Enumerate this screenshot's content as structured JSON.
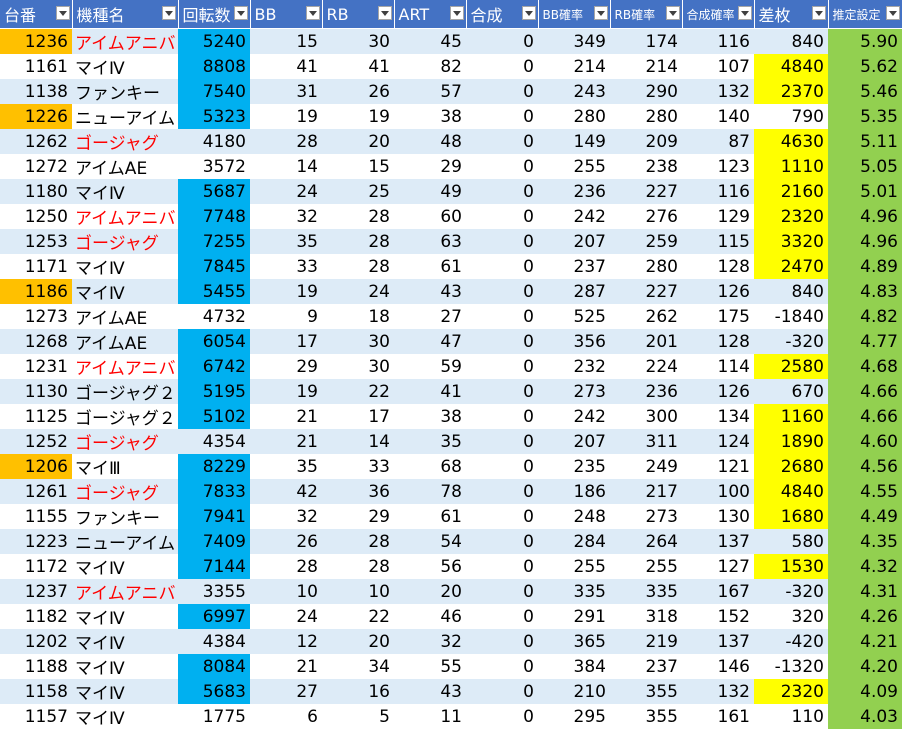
{
  "headers": [
    "台番",
    "機種名",
    "回転数",
    "BB",
    "RB",
    "ART",
    "合成",
    "BB確率",
    "RB確率",
    "合成確率",
    "差枚",
    "推定設定"
  ],
  "colors": {
    "header": "#4472c4",
    "band": "#ddebf7",
    "highlight_number": "#ffc000",
    "highlight_spins": "#00b0f0",
    "highlight_diff": "#ffff00",
    "setting": "#92d050",
    "red_text": "#ff0000"
  },
  "rows": [
    {
      "cells": [
        "1236",
        "アイムアニバ",
        "5240",
        "15",
        "30",
        "45",
        "0",
        "349",
        "174",
        "116",
        "840",
        "5.90"
      ],
      "num_hl": true,
      "name_red": true,
      "spins_hl": true,
      "diff_hl": false
    },
    {
      "cells": [
        "1161",
        "マイⅣ",
        "8808",
        "41",
        "41",
        "82",
        "0",
        "214",
        "214",
        "107",
        "4840",
        "5.62"
      ],
      "num_hl": false,
      "name_red": false,
      "spins_hl": true,
      "diff_hl": true
    },
    {
      "cells": [
        "1138",
        "ファンキー",
        "7540",
        "31",
        "26",
        "57",
        "0",
        "243",
        "290",
        "132",
        "2370",
        "5.46"
      ],
      "num_hl": false,
      "name_red": false,
      "spins_hl": true,
      "diff_hl": true
    },
    {
      "cells": [
        "1226",
        "ニューアイム",
        "5323",
        "19",
        "19",
        "38",
        "0",
        "280",
        "280",
        "140",
        "790",
        "5.35"
      ],
      "num_hl": true,
      "name_red": false,
      "spins_hl": true,
      "diff_hl": false
    },
    {
      "cells": [
        "1262",
        "ゴージャグ",
        "4180",
        "28",
        "20",
        "48",
        "0",
        "149",
        "209",
        "87",
        "4630",
        "5.11"
      ],
      "num_hl": false,
      "name_red": true,
      "spins_hl": false,
      "diff_hl": true
    },
    {
      "cells": [
        "1272",
        "アイムAE",
        "3572",
        "14",
        "15",
        "29",
        "0",
        "255",
        "238",
        "123",
        "1110",
        "5.05"
      ],
      "num_hl": false,
      "name_red": false,
      "spins_hl": false,
      "diff_hl": true
    },
    {
      "cells": [
        "1180",
        "マイⅣ",
        "5687",
        "24",
        "25",
        "49",
        "0",
        "236",
        "227",
        "116",
        "2160",
        "5.01"
      ],
      "num_hl": false,
      "name_red": false,
      "spins_hl": true,
      "diff_hl": true
    },
    {
      "cells": [
        "1250",
        "アイムアニバ",
        "7748",
        "32",
        "28",
        "60",
        "0",
        "242",
        "276",
        "129",
        "2320",
        "4.96"
      ],
      "num_hl": false,
      "name_red": true,
      "spins_hl": true,
      "diff_hl": true
    },
    {
      "cells": [
        "1253",
        "ゴージャグ",
        "7255",
        "35",
        "28",
        "63",
        "0",
        "207",
        "259",
        "115",
        "3320",
        "4.96"
      ],
      "num_hl": false,
      "name_red": true,
      "spins_hl": true,
      "diff_hl": true
    },
    {
      "cells": [
        "1171",
        "マイⅣ",
        "7845",
        "33",
        "28",
        "61",
        "0",
        "237",
        "280",
        "128",
        "2470",
        "4.89"
      ],
      "num_hl": false,
      "name_red": false,
      "spins_hl": true,
      "diff_hl": true
    },
    {
      "cells": [
        "1186",
        "マイⅣ",
        "5455",
        "19",
        "24",
        "43",
        "0",
        "287",
        "227",
        "126",
        "840",
        "4.83"
      ],
      "num_hl": true,
      "name_red": false,
      "spins_hl": true,
      "diff_hl": false
    },
    {
      "cells": [
        "1273",
        "アイムAE",
        "4732",
        "9",
        "18",
        "27",
        "0",
        "525",
        "262",
        "175",
        "-1840",
        "4.82"
      ],
      "num_hl": false,
      "name_red": false,
      "spins_hl": false,
      "diff_hl": false
    },
    {
      "cells": [
        "1268",
        "アイムAE",
        "6054",
        "17",
        "30",
        "47",
        "0",
        "356",
        "201",
        "128",
        "-320",
        "4.77"
      ],
      "num_hl": false,
      "name_red": false,
      "spins_hl": true,
      "diff_hl": false
    },
    {
      "cells": [
        "1231",
        "アイムアニバ",
        "6742",
        "29",
        "30",
        "59",
        "0",
        "232",
        "224",
        "114",
        "2580",
        "4.68"
      ],
      "num_hl": false,
      "name_red": true,
      "spins_hl": true,
      "diff_hl": true
    },
    {
      "cells": [
        "1130",
        "ゴージャグ２",
        "5195",
        "19",
        "22",
        "41",
        "0",
        "273",
        "236",
        "126",
        "670",
        "4.66"
      ],
      "num_hl": false,
      "name_red": false,
      "spins_hl": true,
      "diff_hl": false
    },
    {
      "cells": [
        "1125",
        "ゴージャグ２",
        "5102",
        "21",
        "17",
        "38",
        "0",
        "242",
        "300",
        "134",
        "1160",
        "4.66"
      ],
      "num_hl": false,
      "name_red": false,
      "spins_hl": true,
      "diff_hl": true
    },
    {
      "cells": [
        "1252",
        "ゴージャグ",
        "4354",
        "21",
        "14",
        "35",
        "0",
        "207",
        "311",
        "124",
        "1890",
        "4.60"
      ],
      "num_hl": false,
      "name_red": true,
      "spins_hl": false,
      "diff_hl": true
    },
    {
      "cells": [
        "1206",
        "マイⅢ",
        "8229",
        "35",
        "33",
        "68",
        "0",
        "235",
        "249",
        "121",
        "2680",
        "4.56"
      ],
      "num_hl": true,
      "name_red": false,
      "spins_hl": true,
      "diff_hl": true
    },
    {
      "cells": [
        "1261",
        "ゴージャグ",
        "7833",
        "42",
        "36",
        "78",
        "0",
        "186",
        "217",
        "100",
        "4840",
        "4.55"
      ],
      "num_hl": false,
      "name_red": true,
      "spins_hl": true,
      "diff_hl": true
    },
    {
      "cells": [
        "1155",
        "ファンキー",
        "7941",
        "32",
        "29",
        "61",
        "0",
        "248",
        "273",
        "130",
        "1680",
        "4.49"
      ],
      "num_hl": false,
      "name_red": false,
      "spins_hl": true,
      "diff_hl": true
    },
    {
      "cells": [
        "1223",
        "ニューアイム",
        "7409",
        "26",
        "28",
        "54",
        "0",
        "284",
        "264",
        "137",
        "580",
        "4.35"
      ],
      "num_hl": false,
      "name_red": false,
      "spins_hl": true,
      "diff_hl": false
    },
    {
      "cells": [
        "1172",
        "マイⅣ",
        "7144",
        "28",
        "28",
        "56",
        "0",
        "255",
        "255",
        "127",
        "1530",
        "4.32"
      ],
      "num_hl": false,
      "name_red": false,
      "spins_hl": true,
      "diff_hl": true
    },
    {
      "cells": [
        "1237",
        "アイムアニバ",
        "3355",
        "10",
        "10",
        "20",
        "0",
        "335",
        "335",
        "167",
        "-320",
        "4.31"
      ],
      "num_hl": false,
      "name_red": true,
      "spins_hl": false,
      "diff_hl": false
    },
    {
      "cells": [
        "1182",
        "マイⅣ",
        "6997",
        "24",
        "22",
        "46",
        "0",
        "291",
        "318",
        "152",
        "320",
        "4.26"
      ],
      "num_hl": false,
      "name_red": false,
      "spins_hl": true,
      "diff_hl": false
    },
    {
      "cells": [
        "1202",
        "マイⅣ",
        "4384",
        "12",
        "20",
        "32",
        "0",
        "365",
        "219",
        "137",
        "-420",
        "4.21"
      ],
      "num_hl": false,
      "name_red": false,
      "spins_hl": false,
      "diff_hl": false
    },
    {
      "cells": [
        "1188",
        "マイⅣ",
        "8084",
        "21",
        "34",
        "55",
        "0",
        "384",
        "237",
        "146",
        "-1320",
        "4.20"
      ],
      "num_hl": false,
      "name_red": false,
      "spins_hl": true,
      "diff_hl": false
    },
    {
      "cells": [
        "1158",
        "マイⅣ",
        "5683",
        "27",
        "16",
        "43",
        "0",
        "210",
        "355",
        "132",
        "2320",
        "4.09"
      ],
      "num_hl": false,
      "name_red": false,
      "spins_hl": true,
      "diff_hl": true
    },
    {
      "cells": [
        "1157",
        "マイⅣ",
        "1775",
        "6",
        "5",
        "11",
        "0",
        "295",
        "355",
        "161",
        "110",
        "4.03"
      ],
      "num_hl": false,
      "name_red": false,
      "spins_hl": false,
      "diff_hl": false
    }
  ]
}
